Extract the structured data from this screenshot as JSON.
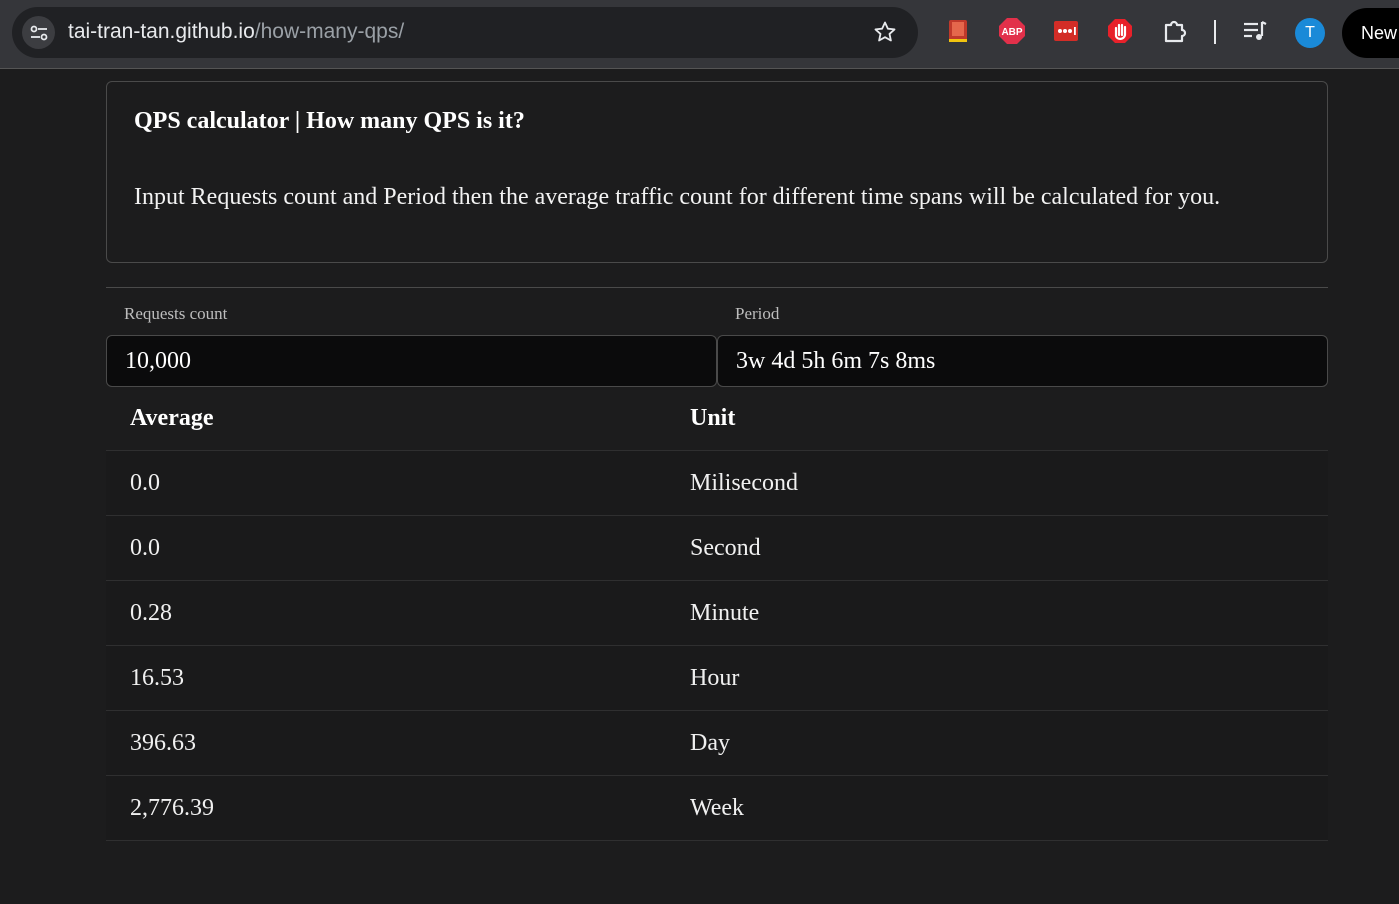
{
  "browser": {
    "url_host": "tai-tran-tan.github.io",
    "url_path": "/how-many-qps/",
    "profile_initial": "T",
    "new_chrome_label": "New",
    "extensions": [
      "book-icon",
      "adblock-plus-icon",
      "lastpass-icon",
      "stop-hand-icon",
      "extensions-puzzle-icon",
      "media-queue-icon"
    ],
    "colors": {
      "toolbar": "#35363a",
      "omnibox": "#202124",
      "avatar": "#1a8ad8"
    }
  },
  "page": {
    "title": "QPS calculator | How many QPS is it?",
    "description": "Input Requests count and Period then the average traffic count for different time spans will be calculated for you.",
    "requests_label": "Requests count",
    "requests_value": "10,000",
    "period_label": "Period",
    "period_value": "3w 4d 5h 6m 7s 8ms"
  },
  "table": {
    "headers": {
      "average": "Average",
      "unit": "Unit"
    },
    "rows": [
      {
        "average": "0.0",
        "unit": "Milisecond"
      },
      {
        "average": "0.0",
        "unit": "Second"
      },
      {
        "average": "0.28",
        "unit": "Minute"
      },
      {
        "average": "16.53",
        "unit": "Hour"
      },
      {
        "average": "396.63",
        "unit": "Day"
      },
      {
        "average": "2,776.39",
        "unit": "Week"
      }
    ]
  }
}
